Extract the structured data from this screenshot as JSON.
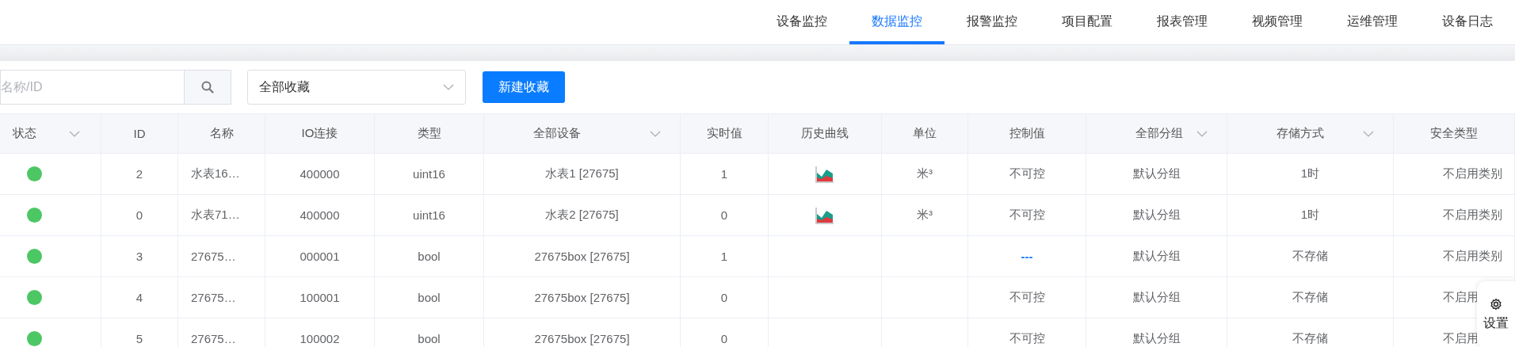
{
  "nav": {
    "tabs": [
      {
        "label": "设备监控",
        "selected": false
      },
      {
        "label": "数据监控",
        "selected": true
      },
      {
        "label": "报警监控",
        "selected": false
      },
      {
        "label": "项目配置",
        "selected": false
      },
      {
        "label": "报表管理",
        "selected": false
      },
      {
        "label": "视频管理",
        "selected": false
      },
      {
        "label": "运维管理",
        "selected": false
      },
      {
        "label": "设备日志",
        "selected": false
      }
    ]
  },
  "toolbar": {
    "search": {
      "placeholder": "名称/ID"
    },
    "favorites": {
      "value": "全部收藏"
    },
    "new_button": "新建收藏"
  },
  "table": {
    "columns": [
      {
        "label": "状态",
        "kind": "filter"
      },
      {
        "label": "ID",
        "kind": "plain"
      },
      {
        "label": "名称",
        "kind": "plain"
      },
      {
        "label": "IO连接",
        "kind": "plain"
      },
      {
        "label": "类型",
        "kind": "plain"
      },
      {
        "label": "全部设备",
        "kind": "filter"
      },
      {
        "label": "实时值",
        "kind": "plain"
      },
      {
        "label": "历史曲线",
        "kind": "plain"
      },
      {
        "label": "单位",
        "kind": "plain"
      },
      {
        "label": "控制值",
        "kind": "plain"
      },
      {
        "label": "全部分组",
        "kind": "filter"
      },
      {
        "label": "存储方式",
        "kind": "filter"
      },
      {
        "label": "安全类型",
        "kind": "plain"
      }
    ],
    "rows": [
      {
        "color": "#4cc764",
        "id": "2",
        "name": "水表16…",
        "io": "400000",
        "type": "uint16",
        "device": "水表1 [27675]",
        "value": "1",
        "history": true,
        "unit": "米³",
        "control": {
          "text": "不可控",
          "kind": "text"
        },
        "group": "默认分组",
        "storage": "1时",
        "security": "不启用类别"
      },
      {
        "color": "#4cc764",
        "id": "0",
        "name": "水表71…",
        "io": "400000",
        "type": "uint16",
        "device": "水表2 [27675]",
        "value": "0",
        "history": true,
        "unit": "米³",
        "control": {
          "text": "不可控",
          "kind": "text"
        },
        "group": "默认分组",
        "storage": "1时",
        "security": "不启用类别"
      },
      {
        "color": "#4cc764",
        "id": "3",
        "name": "27675…",
        "io": "000001",
        "type": "bool",
        "device": "27675box [27675]",
        "value": "1",
        "history": false,
        "control": {
          "text": "---",
          "kind": "link"
        },
        "group": "默认分组",
        "storage": "不存储",
        "security": "不启用类别"
      },
      {
        "color": "#4cc764",
        "id": "4",
        "name": "27675…",
        "io": "100001",
        "type": "bool",
        "device": "27675box [27675]",
        "value": "0",
        "history": false,
        "control": {
          "text": "不可控",
          "kind": "text"
        },
        "group": "默认分组",
        "storage": "不存储",
        "security": "不启用"
      },
      {
        "color": "#4cc764",
        "id": "5",
        "name": "27675…",
        "io": "100002",
        "type": "bool",
        "device": "27675box [27675]",
        "value": "0",
        "history": false,
        "control": {
          "text": "不可控",
          "kind": "text"
        },
        "group": "默认分组",
        "storage": "不存储",
        "security": "不启用"
      }
    ]
  },
  "settings_button": {
    "label": "设置"
  }
}
